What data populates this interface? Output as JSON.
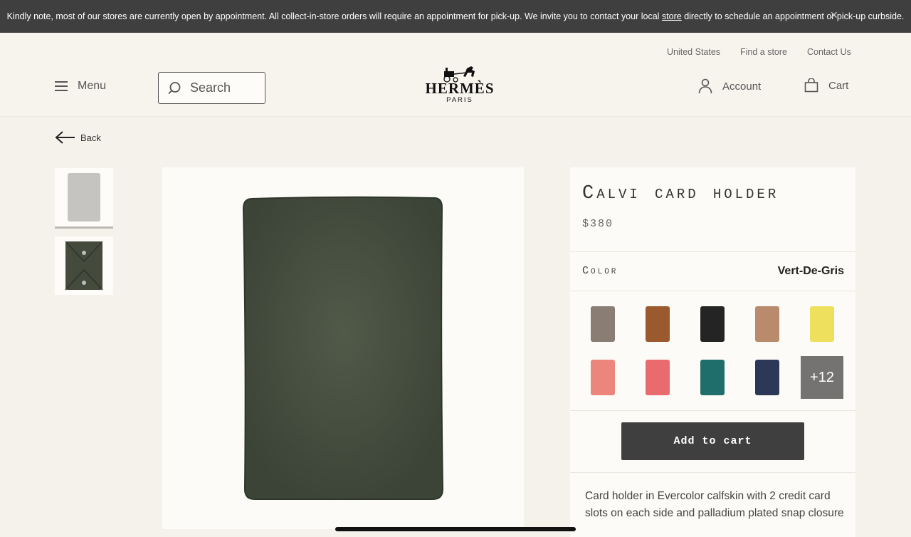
{
  "banner": {
    "text_before": "Kindly note, most of our stores are currently open by appointment. All collect-in-store orders will require an appointment for pick-up. We invite you to contact your local ",
    "link": "store",
    "text_after": " directly to schedule an appointment or pick-up curbside.",
    "close_icon": "close-icon"
  },
  "utility_nav": {
    "country": "United States",
    "find_store": "Find a store",
    "contact": "Contact Us"
  },
  "header": {
    "menu_label": "Menu",
    "search_placeholder": "Search",
    "logo_word": "HERMÈS",
    "logo_sub": "PARIS",
    "account_label": "Account",
    "cart_label": "Cart"
  },
  "nav": {
    "back_label": "Back"
  },
  "product": {
    "title": "Calvi card holder",
    "price": "$380",
    "color_label": "Color",
    "color_value": "Vert-De-Gris",
    "more_colors": "+12",
    "add_to_cart": "Add to cart",
    "description": "Card holder in Evercolor calfskin with 2 credit card slots on each side and palladium plated snap closure"
  },
  "swatch_colors": [
    "#8a7d73",
    "#9a5a2e",
    "#242424",
    "#b98a6b",
    "#eee05c",
    "#ec857c",
    "#ea6b6e",
    "#1f6e6b",
    "#2c3858",
    "#6b4449"
  ],
  "colors": {
    "banner_bg": "#3f3f3f",
    "page_bg": "#f5f2ec",
    "product_color": "#4c5444",
    "button_bg": "#3f3f3f"
  }
}
